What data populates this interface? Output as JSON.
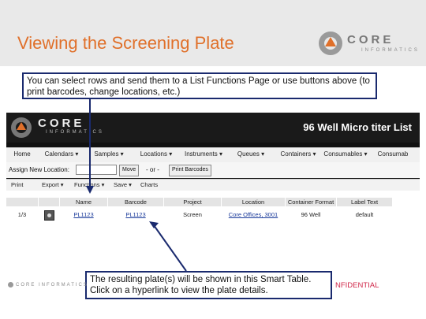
{
  "slide": {
    "title": "Viewing the Screening Plate",
    "logo": {
      "word": "CORE",
      "sub": "INFORMATICS"
    },
    "callout_top": "You can select rows and send them to a List Functions Page or use buttons above (to print barcodes, change locations, etc.)",
    "callout_bottom": "The resulting plate(s) will be shown in this Smart Table. Click on a hyperlink to view the plate details.",
    "footer_logo": "CORE INFORMATICS",
    "confidential": "NFIDENTIAL",
    "colors": {
      "title": "#e0702a",
      "callout_border": "#1a2a6e",
      "confidential": "#d0284a"
    }
  },
  "app": {
    "logo": {
      "word": "CORE",
      "sub": "INFORMATICS"
    },
    "page_heading": "96 Well Micro  titer List",
    "menu": [
      "Home",
      "Calendars ▾",
      "Samples ▾",
      "Locations ▾",
      "Instruments ▾",
      "Queues ▾",
      "Containers ▾",
      "Consumables ▾",
      "Consumab"
    ],
    "location": {
      "label": "Assign New Location:",
      "input_value": "",
      "move_button": "Move",
      "or_text": "- or -",
      "print_button": "Print Barcodes"
    },
    "toolbar": [
      "Print",
      "Export ▾",
      "Functions ▾",
      "Save ▾",
      "Charts"
    ],
    "table": {
      "columns": [
        "",
        "",
        "Name",
        "Barcode",
        "Project",
        "Location",
        "Container Format",
        "Label Text"
      ],
      "rows": [
        [
          "1/3",
          "plate-icon",
          "PL1123",
          "PL1123",
          "Screen",
          "Core Offices, 3001",
          "96 Well",
          "default"
        ]
      ]
    }
  }
}
